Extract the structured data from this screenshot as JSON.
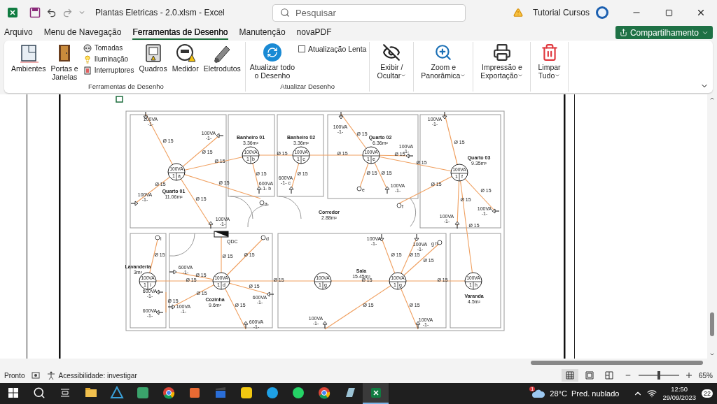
{
  "window": {
    "title": "Plantas Eletricas - 2.0.xlsm  -  Excel",
    "search_placeholder": "Pesquisar",
    "account": "Tutorial Cursos"
  },
  "tabs": [
    {
      "label": "Arquivo",
      "selected": false
    },
    {
      "label": "Menu de Navegação",
      "selected": false
    },
    {
      "label": "Ferramentas de Desenho",
      "selected": true
    },
    {
      "label": "Manutenção",
      "selected": false
    },
    {
      "label": "novaPDF",
      "selected": false
    }
  ],
  "share_button": "Compartilhamento",
  "ribbon": {
    "groups": [
      {
        "label": "Ferramentas de Desenho",
        "items": [
          {
            "kind": "large",
            "label": "Ambientes"
          },
          {
            "kind": "large",
            "label": "Portas e\nJanelas"
          },
          {
            "kind": "list",
            "entries": [
              {
                "label": "Tomadas"
              },
              {
                "label": "Iluminação"
              },
              {
                "label": "Interruptores"
              }
            ]
          },
          {
            "kind": "large",
            "label": "Quadros"
          },
          {
            "kind": "large",
            "label": "Medidor"
          },
          {
            "kind": "large",
            "label": "Eletrodutos"
          }
        ]
      },
      {
        "label": "Atualizar Desenho",
        "items": [
          {
            "kind": "large",
            "label": "Atualizar todo\no Desenho"
          },
          {
            "kind": "checkbox",
            "label": "Atualização Lenta",
            "checked": false
          }
        ]
      },
      {
        "items": [
          {
            "kind": "menu",
            "label": "Exibir /\nOcultar"
          }
        ]
      },
      {
        "items": [
          {
            "kind": "menu",
            "label": "Zoom e\nPanorâmica"
          }
        ]
      },
      {
        "items": [
          {
            "kind": "menu",
            "label": "Impressão e\nExportação"
          }
        ]
      },
      {
        "items": [
          {
            "kind": "menu",
            "label": "Limpar\nTudo"
          }
        ]
      }
    ]
  },
  "plan": {
    "rooms": [
      {
        "name": "Quarto 01",
        "area": "11.06m²"
      },
      {
        "name": "Banheiro 01",
        "area": "3.36m²"
      },
      {
        "name": "Banheiro 02",
        "area": "3.36m²"
      },
      {
        "name": "Quarto 02",
        "area": "6.36m²"
      },
      {
        "name": "Quarto 03",
        "area": "9.35m²"
      },
      {
        "name": "Corredor",
        "area": "2.88m²"
      },
      {
        "name": "Lavanderia",
        "area": "3m²"
      },
      {
        "name": "Cozinha",
        "area": "9.6m²"
      },
      {
        "name": "Sala",
        "area": "15.45m²"
      },
      {
        "name": "Varanda",
        "area": "4.5m²"
      }
    ],
    "lights": [
      {
        "power": "100VA",
        "circuit": "1",
        "switch": "a"
      },
      {
        "power": "100VA",
        "circuit": "1",
        "switch": "b"
      },
      {
        "power": "100VA",
        "circuit": "1",
        "switch": "c"
      },
      {
        "power": "100VA",
        "circuit": "1",
        "switch": "e"
      },
      {
        "power": "100VA",
        "circuit": "1",
        "switch": "f"
      },
      {
        "power": "100VA",
        "circuit": "1",
        "switch": "i"
      },
      {
        "power": "100VA",
        "circuit": "1",
        "switch": "d"
      },
      {
        "power": "100VA",
        "circuit": "1",
        "switch": "g"
      },
      {
        "power": "100VA",
        "circuit": "1",
        "switch": "g"
      },
      {
        "power": "100VA",
        "circuit": "1",
        "switch": "h"
      }
    ],
    "outlets": [
      {
        "power": "100VA",
        "circuit": "-1-"
      },
      {
        "power": "100VA",
        "circuit": "-1-"
      },
      {
        "power": "100VA",
        "circuit": "-1-"
      },
      {
        "power": "100VA",
        "circuit": "-1-"
      },
      {
        "power": "600VA",
        "circuit": "-1-  b"
      },
      {
        "power": "600VA",
        "circuit": "-1-  c"
      },
      {
        "power": "100VA",
        "circuit": "-1-"
      },
      {
        "power": "100VA",
        "circuit": "-1-"
      },
      {
        "power": "100VA",
        "circuit": "-1-"
      },
      {
        "power": "100VA",
        "circuit": "-1-"
      },
      {
        "power": "100VA",
        "circuit": "-1-"
      },
      {
        "power": "100VA",
        "circuit": "-1-"
      },
      {
        "power": "600VA",
        "circuit": "-1-"
      },
      {
        "power": "600VA",
        "circuit": "-1-"
      },
      {
        "power": "600VA",
        "circuit": "-1-"
      },
      {
        "power": "100VA",
        "circuit": "-1-"
      },
      {
        "power": "600VA",
        "circuit": "-1-"
      },
      {
        "power": "600VA",
        "circuit": "-1-"
      },
      {
        "power": "100VA",
        "circuit": "-1-"
      },
      {
        "power": "100VA",
        "circuit": "-1-"
      },
      {
        "power": "100VA",
        "circuit": "-1-"
      },
      {
        "power": "100VA",
        "circuit": "-1-"
      }
    ],
    "switches": [
      "a",
      "e",
      "f",
      "i",
      "d",
      "g  h"
    ],
    "panel": "QDC",
    "conduit_labels": [
      "Ø 15",
      "Ø 15",
      "Ø 15",
      "Ø 15",
      "Ø 15",
      "Ø 15",
      "Ø 15",
      "Ø 15",
      "Ø 15",
      "Ø 15",
      "Ø 15",
      "Ø 15",
      "Ø 15",
      "Ø 15",
      "Ø 15",
      "Ø 15",
      "Ø 15",
      "Ø 15",
      "Ø 15",
      "Ø 15",
      "Ø 15",
      "Ø 15",
      "Ø 15",
      "Ø 15",
      "Ø 15",
      "Ø 15",
      "Ø 15",
      "Ø 15",
      "Ø 15",
      "Ø 15",
      "Ø 15",
      "Ø 15",
      "Ø 15",
      "Ø 15",
      "Ø 15",
      "Ø 15",
      "Ø 15"
    ]
  },
  "status_bar": {
    "status": "Pronto",
    "accessibility": "Acessibilidade: investigar",
    "views": [
      {
        "kind": "normal",
        "selected": true
      },
      {
        "kind": "page-layout",
        "selected": false
      },
      {
        "kind": "page-break",
        "selected": false
      }
    ],
    "zoom": {
      "level": 0.5,
      "reading": "65%"
    }
  },
  "taskbar": {
    "apps": [
      {
        "kind": "explorer",
        "selected": false
      },
      {
        "kind": "triangle",
        "selected": false
      },
      {
        "kind": "green",
        "selected": false
      },
      {
        "kind": "chrome",
        "selected": false
      },
      {
        "kind": "orange",
        "selected": false
      },
      {
        "kind": "clapper",
        "selected": false
      },
      {
        "kind": "yellow",
        "selected": false
      },
      {
        "kind": "edge",
        "selected": false
      },
      {
        "kind": "whatsapp",
        "selected": false
      },
      {
        "kind": "chrome",
        "selected": false
      },
      {
        "kind": "notes",
        "selected": false
      },
      {
        "kind": "excel",
        "selected": true
      }
    ],
    "weather": {
      "badge": "1",
      "temperature": "28°C",
      "condition": "Pred. nublado"
    },
    "time": "12:50",
    "date": "29/09/2023",
    "notifications": "22"
  }
}
